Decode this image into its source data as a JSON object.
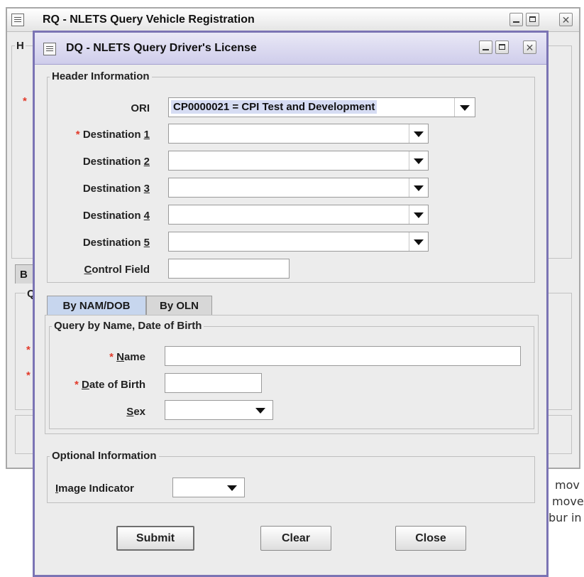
{
  "back_window": {
    "title": "RQ - NLETS Query Vehicle Registration",
    "group_label_partial": "H",
    "tab_partial": "B",
    "group2_label_partial": "Q",
    "close_symbol": "✕"
  },
  "background_text": {
    "line1": "mov",
    "line2": "move",
    "line3": "bur in"
  },
  "dialog": {
    "title": "DQ - NLETS Query Driver's License",
    "close_symbol": "✕",
    "header_group": {
      "label": "Header Information",
      "ori_label": "ORI",
      "ori_value": "CP0000021 = CPI Test and Development",
      "destinations": [
        {
          "prefix": "Destination ",
          "num": "1",
          "required": true,
          "value": ""
        },
        {
          "prefix": "Destination ",
          "num": "2",
          "required": false,
          "value": ""
        },
        {
          "prefix": "Destination ",
          "num": "3",
          "required": false,
          "value": ""
        },
        {
          "prefix": "Destination ",
          "num": "4",
          "required": false,
          "value": ""
        },
        {
          "prefix": "Destination ",
          "num": "5",
          "required": false,
          "value": ""
        }
      ],
      "control_field": {
        "key": "C",
        "rest": "ontrol Field",
        "value": ""
      }
    },
    "tabs": [
      {
        "label": "By NAM/DOB",
        "active": true
      },
      {
        "label": "By OLN",
        "active": false
      }
    ],
    "query_group": {
      "label": "Query by Name, Date of Birth",
      "name": {
        "key": "N",
        "rest": "ame",
        "value": ""
      },
      "dob": {
        "key": "D",
        "rest": "ate of Birth",
        "value": ""
      },
      "sex": {
        "key": "S",
        "rest": "ex",
        "value": ""
      }
    },
    "optional_group": {
      "label": "Optional Information",
      "image_indicator": {
        "key": "I",
        "rest": "mage Indicator",
        "value": ""
      }
    },
    "buttons": {
      "submit": "Submit",
      "clear": "Clear",
      "close": "Close"
    }
  },
  "colors": {
    "dialog_border": "#7b74b4",
    "required_star": "#e23a2a",
    "active_tab": "#c7d6ee"
  },
  "icons": [
    "window-menu-icon",
    "minimize-icon",
    "maximize-icon",
    "close-icon",
    "dropdown-arrow-icon"
  ]
}
